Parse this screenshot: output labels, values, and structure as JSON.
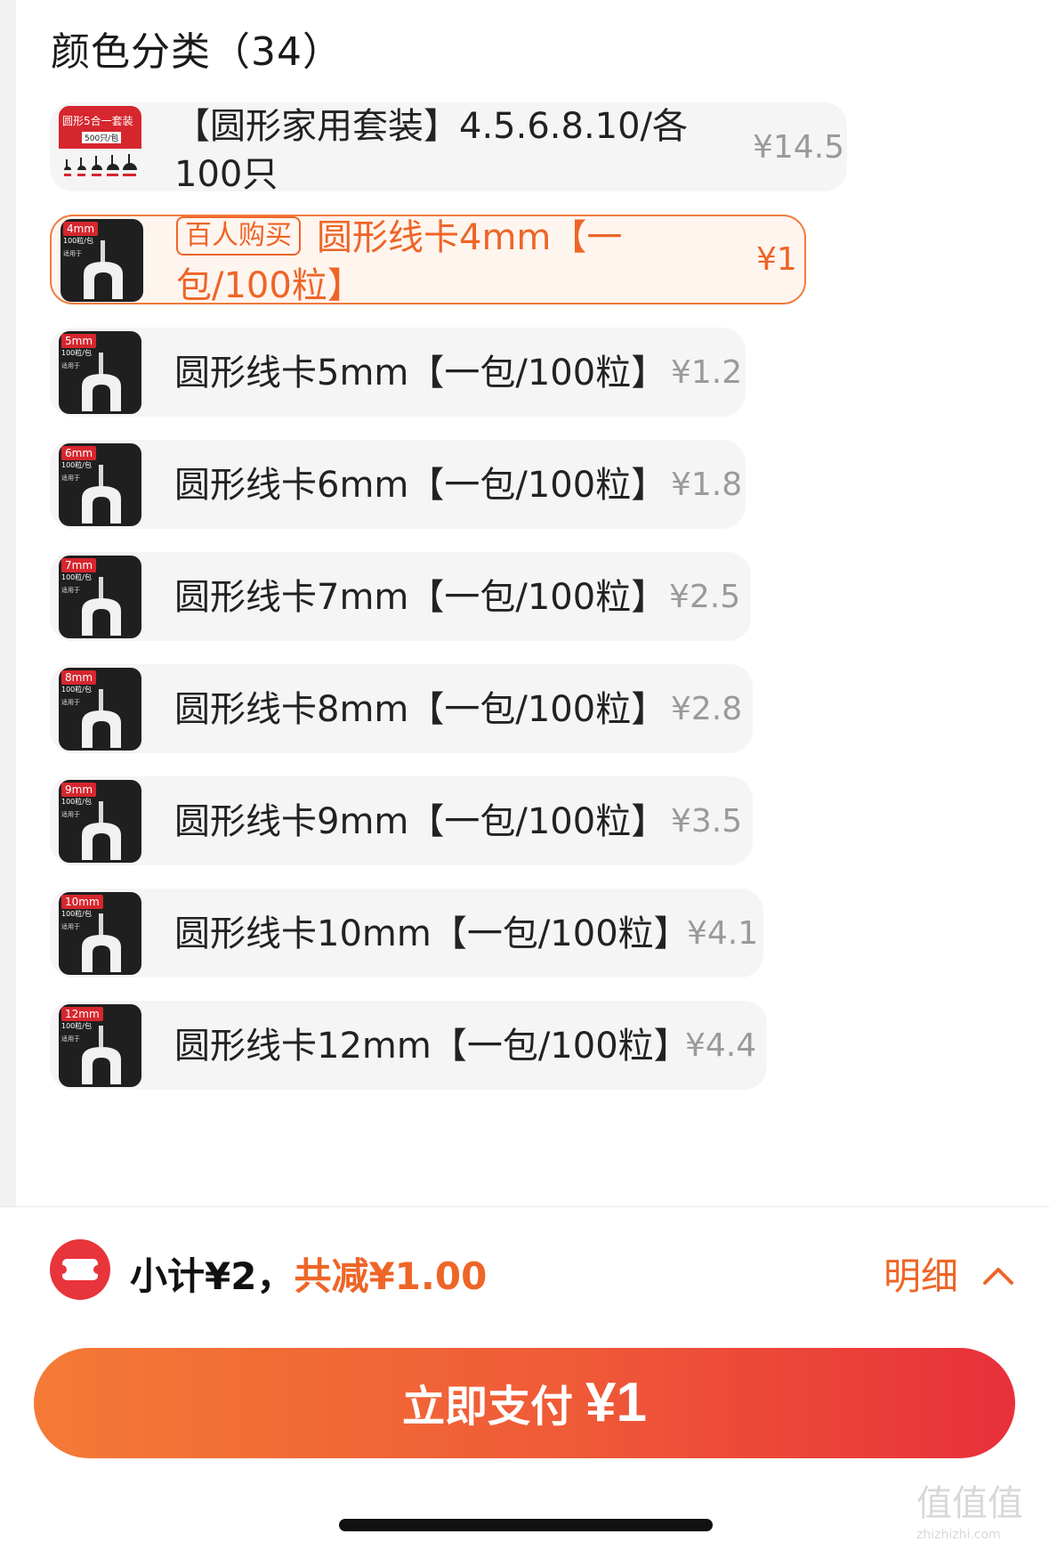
{
  "section_title": "颜色分类（34）",
  "skus": [
    {
      "name": "【圆形家用套装】4.5.6.8.10/各100只",
      "price": "¥14.5",
      "thumb_tag": "圆形5合一套装",
      "thumb_sub": "500只/包"
    },
    {
      "badge": "百人购买",
      "name": "圆形线卡4mm【一包/100粒】",
      "price": "¥1",
      "thumb_tag": "4mm",
      "thumb_sub": "100粒/包",
      "thumb_sub2": "适用于",
      "selected": true
    },
    {
      "name": "圆形线卡5mm【一包/100粒】",
      "price": "¥1.2",
      "thumb_tag": "5mm",
      "thumb_sub": "100粒/包",
      "thumb_sub2": "适用于"
    },
    {
      "name": "圆形线卡6mm【一包/100粒】",
      "price": "¥1.8",
      "thumb_tag": "6mm",
      "thumb_sub": "100粒/包",
      "thumb_sub2": "适用于"
    },
    {
      "name": "圆形线卡7mm【一包/100粒】",
      "price": "¥2.5",
      "thumb_tag": "7mm",
      "thumb_sub": "100粒/包",
      "thumb_sub2": "适用于"
    },
    {
      "name": "圆形线卡8mm【一包/100粒】",
      "price": "¥2.8",
      "thumb_tag": "8mm",
      "thumb_sub": "100粒/包",
      "thumb_sub2": "适用于"
    },
    {
      "name": "圆形线卡9mm【一包/100粒】",
      "price": "¥3.5",
      "thumb_tag": "9mm",
      "thumb_sub": "100粒/包",
      "thumb_sub2": "适用于"
    },
    {
      "name": "圆形线卡10mm【一包/100粒】",
      "price": "¥4.1",
      "thumb_tag": "10mm",
      "thumb_sub": "100粒/包",
      "thumb_sub2": "适用于"
    },
    {
      "name": "圆形线卡12mm【一包/100粒】",
      "price": "¥4.4",
      "thumb_tag": "12mm",
      "thumb_sub": "100粒/包",
      "thumb_sub2": "适用于"
    }
  ],
  "summary": {
    "subtotal": "小计¥2，",
    "discount": "共减¥1.00",
    "detail_label": "明细",
    "pay_label": "立即支付",
    "pay_amount": "¥1"
  },
  "watermark": {
    "main": "值值值",
    "sub": "zhizhizhi.com"
  },
  "colors": {
    "accent": "#ee6527",
    "pay_start": "#f47a36",
    "pay_end": "#e8303b",
    "muted_price": "#9a9a9a"
  },
  "icons": {
    "coupon": "coupon-icon",
    "detail": "chevron-up-icon"
  }
}
